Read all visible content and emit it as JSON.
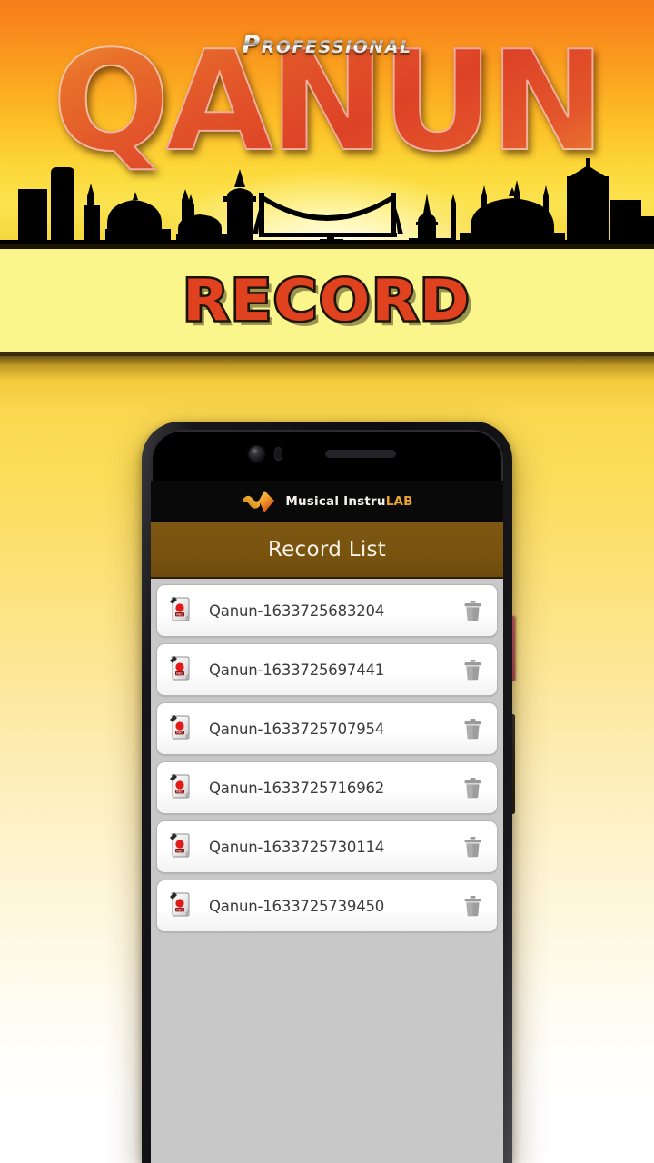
{
  "hero": {
    "pro_label": "Professional",
    "title": "QANUN",
    "skyline_name": "istanbul-skyline-silhouette"
  },
  "record_band": {
    "label": "RECORD"
  },
  "phone": {
    "power_button_label": "power-button",
    "volume_button_label": "volume-button",
    "camera_label": "front-camera",
    "sensor_label": "proximity-sensor",
    "speaker_label": "earpiece-speaker"
  },
  "app": {
    "brand_primary": "Musical Instru",
    "brand_accent": "LAB",
    "logo_name": "musical-instrulab-logo",
    "screen_title": "Record List",
    "records": [
      {
        "name": "Qanun-1633725683204",
        "icon": "record-file-icon",
        "delete_label": "delete-record"
      },
      {
        "name": "Qanun-1633725697441",
        "icon": "record-file-icon",
        "delete_label": "delete-record"
      },
      {
        "name": "Qanun-1633725707954",
        "icon": "record-file-icon",
        "delete_label": "delete-record"
      },
      {
        "name": "Qanun-1633725716962",
        "icon": "record-file-icon",
        "delete_label": "delete-record"
      },
      {
        "name": "Qanun-1633725730114",
        "icon": "record-file-icon",
        "delete_label": "delete-record"
      },
      {
        "name": "Qanun-1633725739450",
        "icon": "record-file-icon",
        "delete_label": "delete-record"
      }
    ]
  },
  "colors": {
    "hero_orange": "#f77d1a",
    "hero_gold": "#fbe350",
    "band_yellow": "#faf68c",
    "record_red": "#e0411f",
    "title_bar_brown": "#7c5612",
    "brand_accent": "#e8a32c",
    "list_bg_gray": "#c8c8c8",
    "rec_dot_red": "#e01b18"
  }
}
